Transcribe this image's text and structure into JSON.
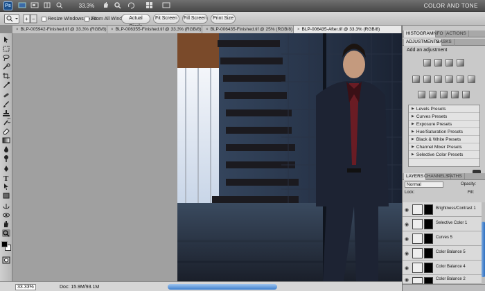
{
  "app": {
    "logo": "Ps",
    "zoom": "33.3%",
    "workspace": "COLOR AND TONE"
  },
  "options": {
    "resize_windows": "Resize Windows To Fit",
    "zoom_all": "Zoom All Windows",
    "actual_pixels": "Actual Pixels",
    "fit_screen": "Fit Screen",
    "fill_screen": "Fill Screen",
    "print_size": "Print Size"
  },
  "tabs": [
    {
      "label": "BLP-005942-Finished.tif @ 33.3% (RGB/8)"
    },
    {
      "label": "BLP-006355-Finished.tif @ 33.3% (RGB/8)"
    },
    {
      "label": "BLP-006435-Finished.tif @ 25% (RGB/8)"
    },
    {
      "label": "BLP-006435-After.tif @ 33.3% (RGB/8)"
    }
  ],
  "status": {
    "zoom": "33.33%",
    "doc": "Doc: 15.9M/93.1M"
  },
  "panels": {
    "top_tabs": [
      "HISTOGRAM",
      "INFO",
      "ACTIONS"
    ],
    "adj_tabs": [
      "ADJUSTMENTS",
      "MASKS"
    ],
    "adj_title": "Add an adjustment",
    "presets": [
      "Levels Presets",
      "Curves Presets",
      "Exposure Presets",
      "Hue/Saturation Presets",
      "Black & White Presets",
      "Channel Mixer Presets",
      "Selective Color Presets"
    ],
    "layer_tabs": [
      "LAYERS",
      "CHANNELS",
      "PATHS"
    ],
    "blend_mode": "Normal",
    "opacity_label": "Opacity:",
    "lock_label": "Lock:",
    "fill_label": "Fill:",
    "layers": [
      "Brightness/Contrast 1",
      "Selective Color 1",
      "Curves 5",
      "Color Balance 5",
      "Color Balance 4",
      "Color Balance 2"
    ]
  }
}
